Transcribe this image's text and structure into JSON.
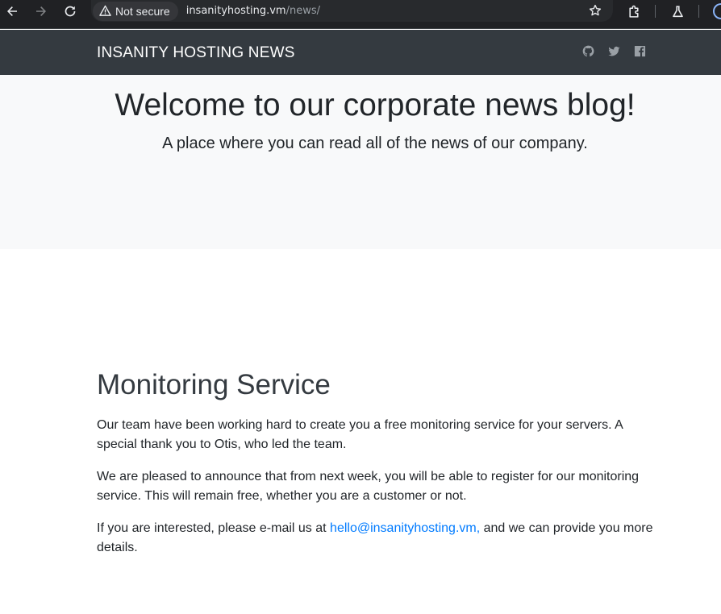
{
  "browser": {
    "security_label": "Not secure",
    "url_host": "insanityhosting.vm",
    "url_path": "/news/"
  },
  "site": {
    "brand": "INSANITY HOSTING NEWS",
    "social_icons": [
      "github-icon",
      "twitter-icon",
      "facebook-icon"
    ]
  },
  "hero": {
    "title": "Welcome to our corporate news blog!",
    "lead": "A place where you can read all of the news of our company."
  },
  "article": {
    "title": "Monitoring Service",
    "p1": "Our team have been working hard to create you a free monitoring service for your servers. A special thank you to Otis, who led the team.",
    "p2": "We are pleased to announce that from next week, you will be able to register for our monitoring service. This will remain free, whether you are a customer or not.",
    "p3_before": "If you are interested, please e-mail us at ",
    "p3_link": "hello@insanityhosting.vm,",
    "p3_after": " and we can provide you more details."
  },
  "colors": {
    "navbar": "#343a40",
    "jumbotron": "#f8f9fa",
    "link": "#007bff"
  }
}
